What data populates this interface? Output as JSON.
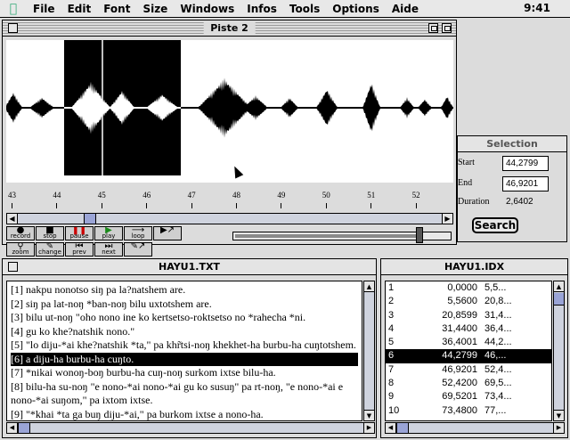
{
  "menubar": {
    "items": [
      "File",
      "Edit",
      "Font",
      "Size",
      "Windows",
      "Infos",
      "Tools",
      "Options",
      "Aide"
    ],
    "clock": "9:41"
  },
  "piste": {
    "title": "Piste 2",
    "ruler_labels": [
      "43",
      "44",
      "45",
      "46",
      "47",
      "48",
      "49",
      "50",
      "51",
      "52"
    ],
    "selection_region": {
      "start_fraction": 0.13,
      "end_fraction": 0.39
    },
    "playhead_fraction": 0.215,
    "scroll_position": 0.16,
    "volume_level": 0.86,
    "buttons": {
      "record": "record",
      "stop": "stop",
      "pause": "pause",
      "play": "play",
      "loop": "loop",
      "zoom": "zoom",
      "change": "change",
      "prev": "prev",
      "next": "next"
    }
  },
  "selection": {
    "title": "Selection",
    "start_label": "Start",
    "start_value": "44,2799",
    "end_label": "End",
    "end_value": "46,9201",
    "duration_label": "Duration",
    "duration_value": "2,6402",
    "search_label": "Search"
  },
  "txt": {
    "title": "HAYU1.TXT",
    "lines": [
      "[1] nakpu nonotso siŋ pa la?natshem are.",
      "[2] siŋ pa lat-noŋ *ban-noŋ bilu uxtotshem are.",
      "[3] bilu ut-noŋ \"oho nono ine ko kertsetso-roktsetso no *rahecha *ni.",
      "[4] gu ko khe?natshik nono.\"",
      "[5] \"lo diju-*ai khe?natshik *ta,\" pa khr̃tsi-noŋ khekhet-ha burbu-ha cuŋtotshem.",
      "[6] a diju-ha burbu-ha cuŋto.",
      "[7] *nikai wonoŋ-boŋ burbu-ha cuŋ-noŋ surkom ixtse bilu-ha.",
      "[8] bilu-ha su-noŋ \"e nono-*ai nono-*ai gu ko susuŋ\" pa rt-noŋ, \"e nono-*ai e nono-*ai suŋom,\" pa ixtom ixtse.",
      "[9] \"*khai *ta ga buŋ diju-*ai,\" pa burkom ixtse a nono-ha."
    ],
    "selected_index": 5
  },
  "idx": {
    "title": "HAYU1.IDX",
    "rows": [
      [
        "1",
        "0,0000",
        "5,5..."
      ],
      [
        "2",
        "5,5600",
        "20,8..."
      ],
      [
        "3",
        "20,8599",
        "31,4..."
      ],
      [
        "4",
        "31,4400",
        "36,4..."
      ],
      [
        "5",
        "36,4001",
        "44,2..."
      ],
      [
        "6",
        "44,2799",
        "46,..."
      ],
      [
        "7",
        "46,9201",
        "52,4..."
      ],
      [
        "8",
        "52,4200",
        "69,5..."
      ],
      [
        "9",
        "69,5201",
        "73,4..."
      ],
      [
        "10",
        "73,4800",
        "77,..."
      ]
    ],
    "selected_index": 5
  }
}
